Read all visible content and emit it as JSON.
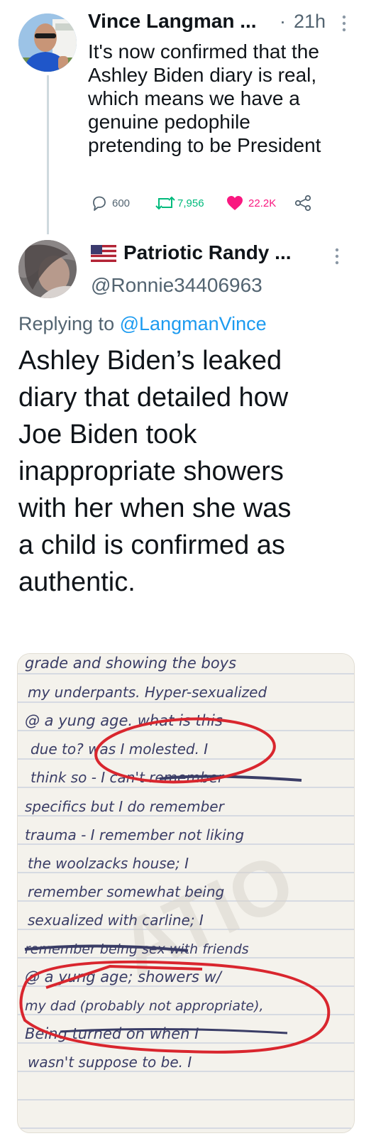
{
  "tweet1": {
    "author_name": "Vince Langman ...",
    "separator": "·",
    "time": "21h",
    "text_lines": [
      "It's now confirmed that the",
      "Ashley Biden diary is real,",
      "which means we have a",
      "genuine pedophile",
      "pretending to be President"
    ],
    "replies": "600",
    "retweets": "7,956",
    "likes": "22.2K"
  },
  "tweet2": {
    "author_name": "Patriotic Randy ...",
    "handle": "@Ronnie34406963",
    "replying_prefix": "Replying to",
    "replying_to": "@LangmanVince",
    "text_lines": [
      "Ashley Biden’s leaked",
      "diary that detailed how",
      "Joe Biden took",
      "inappropriate showers",
      "with her when she was",
      "a child is confirmed as",
      "authentic."
    ],
    "diary_lines": [
      "grade and showing the boys",
      "my underpants. Hyper-sexualized",
      "@ a yung age. what is this",
      "due to? was I molested. I",
      "think so - I can't remember",
      "specifics but I do remember",
      "trauma - I remember not liking",
      "the woolzacks house; I",
      "remember somewhat being",
      "sexualized with carline; I",
      "remember being sex with friends",
      "@ a yung age; showers w/",
      "my dad (probably not appropriate),",
      "Being turned on when I",
      "wasn't suppose to be. I"
    ]
  },
  "colors": {
    "like_heart": "#f91880",
    "retweet": "#00ba7c",
    "link": "#1d9bf0",
    "ink": "#3a3d66",
    "circle": "#d9262e"
  }
}
